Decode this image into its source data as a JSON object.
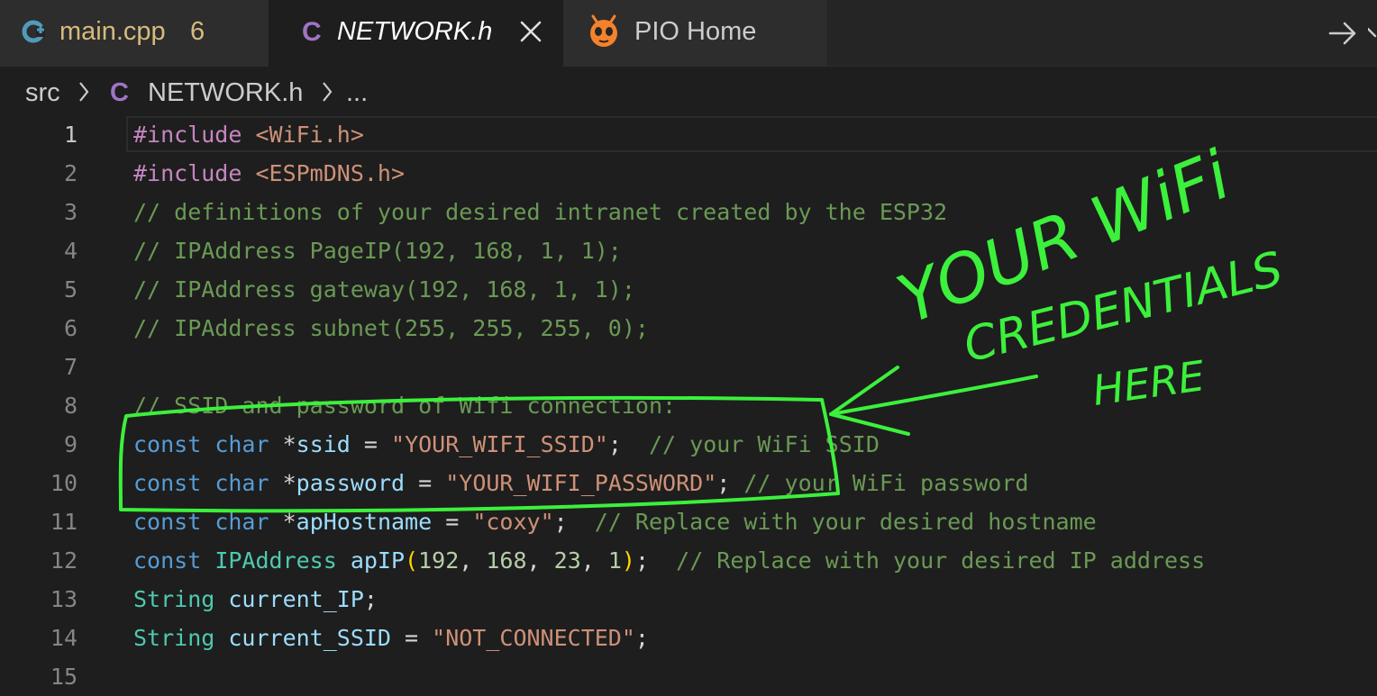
{
  "tabs": [
    {
      "label": "main.cpp",
      "badge": "6",
      "icon": "cpp-file-icon"
    },
    {
      "label": "NETWORK.h",
      "icon": "c-header-file-icon",
      "active": true
    },
    {
      "label": "PIO Home",
      "icon": "platformio-alien-icon"
    }
  ],
  "breadcrumb": {
    "folder": "src",
    "file_icon_letter": "C",
    "file": "NETWORK.h",
    "more": "..."
  },
  "tab_icon_letter": "C",
  "editor": {
    "active_line": 1,
    "lines": [
      {
        "n": "1",
        "tokens": [
          [
            "pp",
            "#include "
          ],
          [
            "str",
            "<WiFi.h>"
          ]
        ]
      },
      {
        "n": "2",
        "tokens": [
          [
            "pp",
            "#include "
          ],
          [
            "str",
            "<ESPmDNS.h>"
          ]
        ]
      },
      {
        "n": "3",
        "tokens": [
          [
            "cm",
            "// definitions of your desired intranet created by the ESP32"
          ]
        ]
      },
      {
        "n": "4",
        "tokens": [
          [
            "cm",
            "// IPAddress PageIP(192, 168, 1, 1);"
          ]
        ]
      },
      {
        "n": "5",
        "tokens": [
          [
            "cm",
            "// IPAddress gateway(192, 168, 1, 1);"
          ]
        ]
      },
      {
        "n": "6",
        "tokens": [
          [
            "cm",
            "// IPAddress subnet(255, 255, 255, 0);"
          ]
        ]
      },
      {
        "n": "7",
        "tokens": []
      },
      {
        "n": "8",
        "tokens": [
          [
            "cm",
            "// SSID and password of Wifi connection:"
          ]
        ]
      },
      {
        "n": "9",
        "tokens": [
          [
            "kw",
            "const "
          ],
          [
            "kw",
            "char "
          ],
          [
            "pun",
            "*"
          ],
          [
            "var",
            "ssid"
          ],
          [
            "pun",
            " = "
          ],
          [
            "str",
            "\"YOUR_WIFI_SSID\""
          ],
          [
            "pun",
            ";  "
          ],
          [
            "cm",
            "// your WiFi SSID"
          ]
        ]
      },
      {
        "n": "10",
        "tokens": [
          [
            "kw",
            "const "
          ],
          [
            "kw",
            "char "
          ],
          [
            "pun",
            "*"
          ],
          [
            "var",
            "password"
          ],
          [
            "pun",
            " = "
          ],
          [
            "str",
            "\"YOUR_WIFI_PASSWORD\""
          ],
          [
            "pun",
            "; "
          ],
          [
            "cm",
            "// your WiFi password"
          ]
        ]
      },
      {
        "n": "11",
        "tokens": [
          [
            "kw",
            "const "
          ],
          [
            "kw",
            "char "
          ],
          [
            "pun",
            "*"
          ],
          [
            "var",
            "apHostname"
          ],
          [
            "pun",
            " = "
          ],
          [
            "str",
            "\"coxy\""
          ],
          [
            "pun",
            ";  "
          ],
          [
            "cm",
            "// Replace with your desired hostname"
          ]
        ]
      },
      {
        "n": "12",
        "tokens": [
          [
            "kw",
            "const "
          ],
          [
            "ty",
            "IPAddress "
          ],
          [
            "var",
            "apIP"
          ],
          [
            "paren",
            "("
          ],
          [
            "num",
            "192"
          ],
          [
            "pun",
            ", "
          ],
          [
            "num",
            "168"
          ],
          [
            "pun",
            ", "
          ],
          [
            "num",
            "23"
          ],
          [
            "pun",
            ", "
          ],
          [
            "num",
            "1"
          ],
          [
            "paren",
            ")"
          ],
          [
            "pun",
            ";  "
          ],
          [
            "cm",
            "// Replace with your desired IP address"
          ]
        ]
      },
      {
        "n": "13",
        "tokens": [
          [
            "ty",
            "String "
          ],
          [
            "var",
            "current_IP"
          ],
          [
            "pun",
            ";"
          ]
        ]
      },
      {
        "n": "14",
        "tokens": [
          [
            "ty",
            "String "
          ],
          [
            "var",
            "current_SSID"
          ],
          [
            "pun",
            " = "
          ],
          [
            "str",
            "\"NOT_CONNECTED\""
          ],
          [
            "pun",
            ";"
          ]
        ]
      },
      {
        "n": "15",
        "tokens": []
      }
    ]
  },
  "annotation": {
    "text_lines": [
      "YOUR WiFi",
      "CREDENTIALS",
      "HERE"
    ],
    "color": "#3cf03c"
  },
  "colors": {
    "tab_modified": "#d7ba7d",
    "c_icon": "#a074c4",
    "cpp_icon": "#519aba",
    "pio_icon": "#f5822a"
  }
}
